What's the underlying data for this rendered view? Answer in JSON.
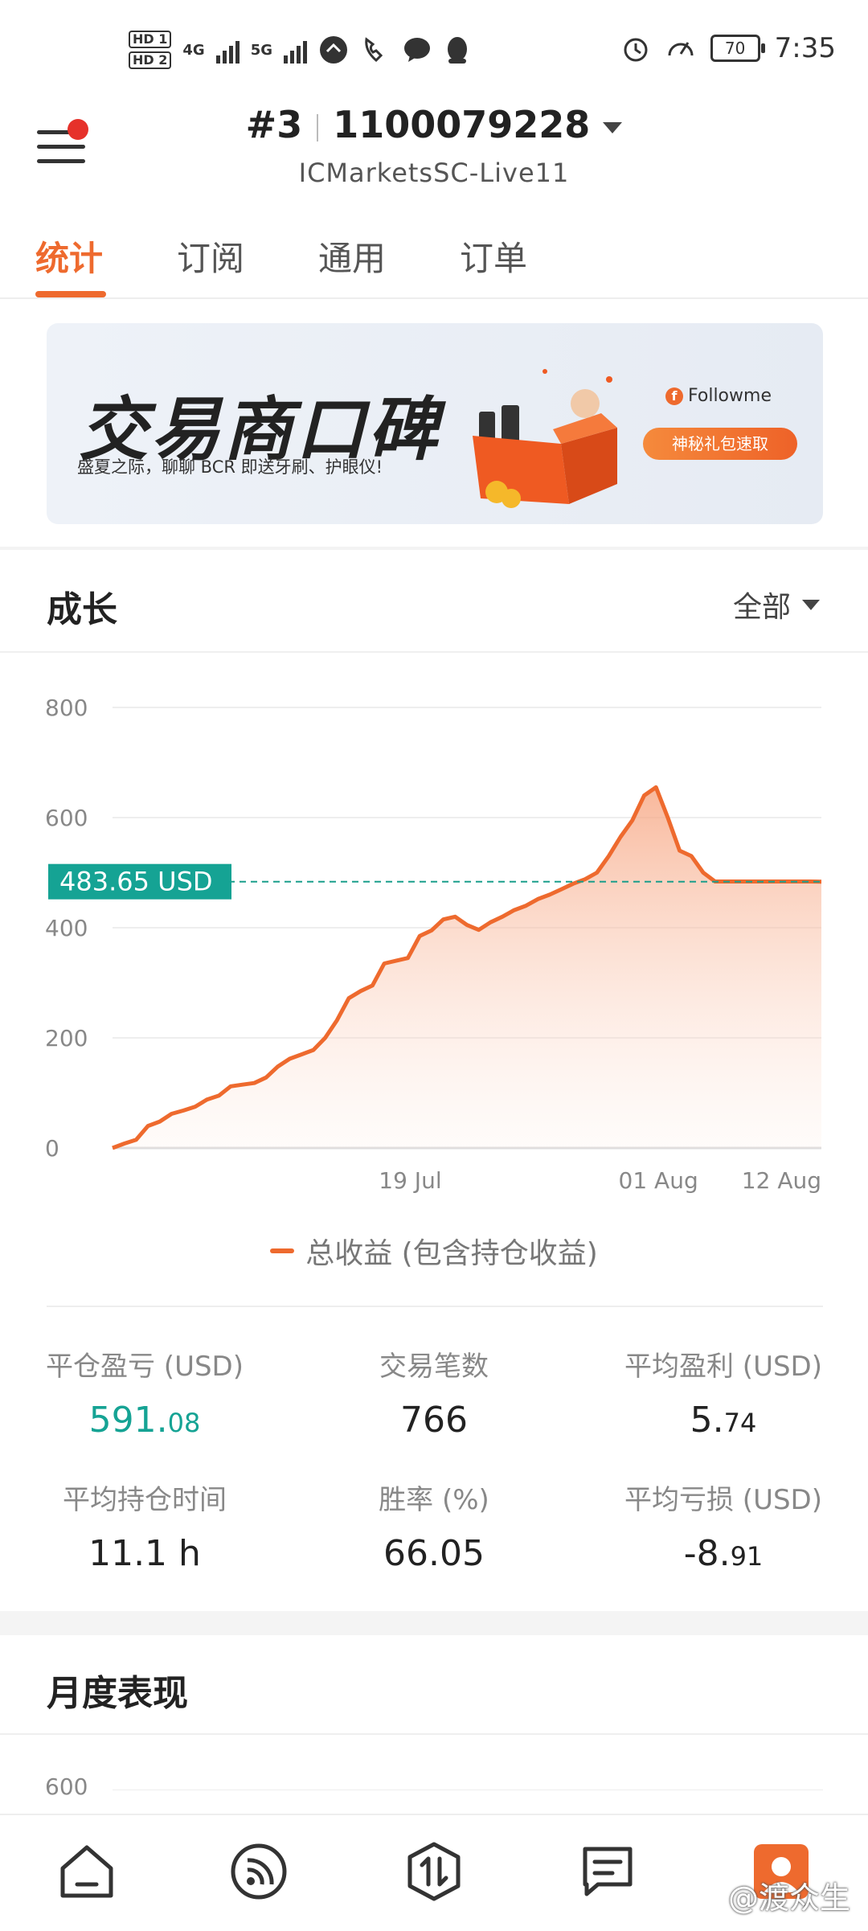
{
  "status_bar": {
    "sim1": "HD 1",
    "sim2": "HD 2",
    "net1": "4G",
    "net2": "5G",
    "battery": "70",
    "time": "7:35"
  },
  "header": {
    "account_no": "#3",
    "account_id": "1100079228",
    "server": "ICMarketsSC-Live11"
  },
  "tabs": [
    {
      "label": "统计",
      "active": true
    },
    {
      "label": "订阅",
      "active": false
    },
    {
      "label": "通用",
      "active": false
    },
    {
      "label": "订单",
      "active": false
    }
  ],
  "banner": {
    "title": "交易商口碑",
    "subtitle": "盛夏之际，聊聊 BCR 即送牙刷、护眼仪!",
    "brand": "Followme",
    "button": "神秘礼包速取"
  },
  "growth": {
    "title": "成长",
    "filter": "全部"
  },
  "chart_data": {
    "type": "area",
    "title": "",
    "xlabel": "",
    "ylabel": "",
    "ylim": [
      0,
      800
    ],
    "y_ticks": [
      "800",
      "600",
      "400",
      "200",
      "0"
    ],
    "x_ticks": [
      "19 Jul",
      "01 Aug",
      "12 Aug"
    ],
    "current_value_label": "483.65 USD",
    "current_value": 483.65,
    "legend_position": "bottom",
    "grid": true,
    "series": [
      {
        "name": "总收益 (包含持仓收益)",
        "color": "#ee6a2e",
        "x": [
          0,
          1,
          2,
          3,
          4,
          5,
          6,
          7,
          8,
          9,
          10,
          11,
          12,
          13,
          14,
          15,
          16,
          17,
          18,
          19,
          20,
          21,
          22,
          23,
          24,
          25,
          26,
          27,
          28,
          29,
          30,
          31,
          32,
          33,
          34,
          35,
          36,
          37,
          38,
          39,
          40,
          41,
          42,
          43,
          44,
          45,
          46,
          47,
          48,
          49,
          50,
          51,
          52,
          53,
          54,
          55,
          56,
          57,
          58,
          59,
          60
        ],
        "values": [
          0,
          8,
          15,
          40,
          48,
          62,
          68,
          75,
          88,
          95,
          112,
          115,
          118,
          128,
          148,
          162,
          170,
          178,
          200,
          232,
          272,
          285,
          295,
          335,
          340,
          345,
          385,
          395,
          415,
          420,
          405,
          396,
          410,
          420,
          432,
          440,
          452,
          460,
          470,
          480,
          488,
          500,
          530,
          565,
          595,
          640,
          655,
          600,
          540,
          530,
          500,
          484,
          484,
          484,
          484,
          484,
          484,
          484,
          484,
          484,
          483.65
        ]
      }
    ]
  },
  "stats": [
    {
      "label": "平仓盈亏 (USD)",
      "int": "591.",
      "dec": "08",
      "highlight": "#15a394"
    },
    {
      "label": "交易笔数",
      "int": "766",
      "dec": ""
    },
    {
      "label": "平均盈利 (USD)",
      "int": "5.",
      "dec": "74"
    },
    {
      "label": "平均持仓时间",
      "int": "11.1 h",
      "dec": ""
    },
    {
      "label": "胜率 (%)",
      "int": "66.05",
      "dec": ""
    },
    {
      "label": "平均亏损 (USD)",
      "int": "-8.",
      "dec": "91"
    }
  ],
  "monthly": {
    "title": "月度表现",
    "first_tick": "600"
  },
  "bottom_nav": [
    {
      "icon": "home-icon"
    },
    {
      "icon": "feed-icon"
    },
    {
      "icon": "trade-icon"
    },
    {
      "icon": "message-icon"
    },
    {
      "icon": "profile-icon"
    }
  ],
  "watermark": "@渡众生",
  "colors": {
    "accent": "#ee6a2e",
    "positive": "#15a394",
    "badge": "#e6312a"
  }
}
